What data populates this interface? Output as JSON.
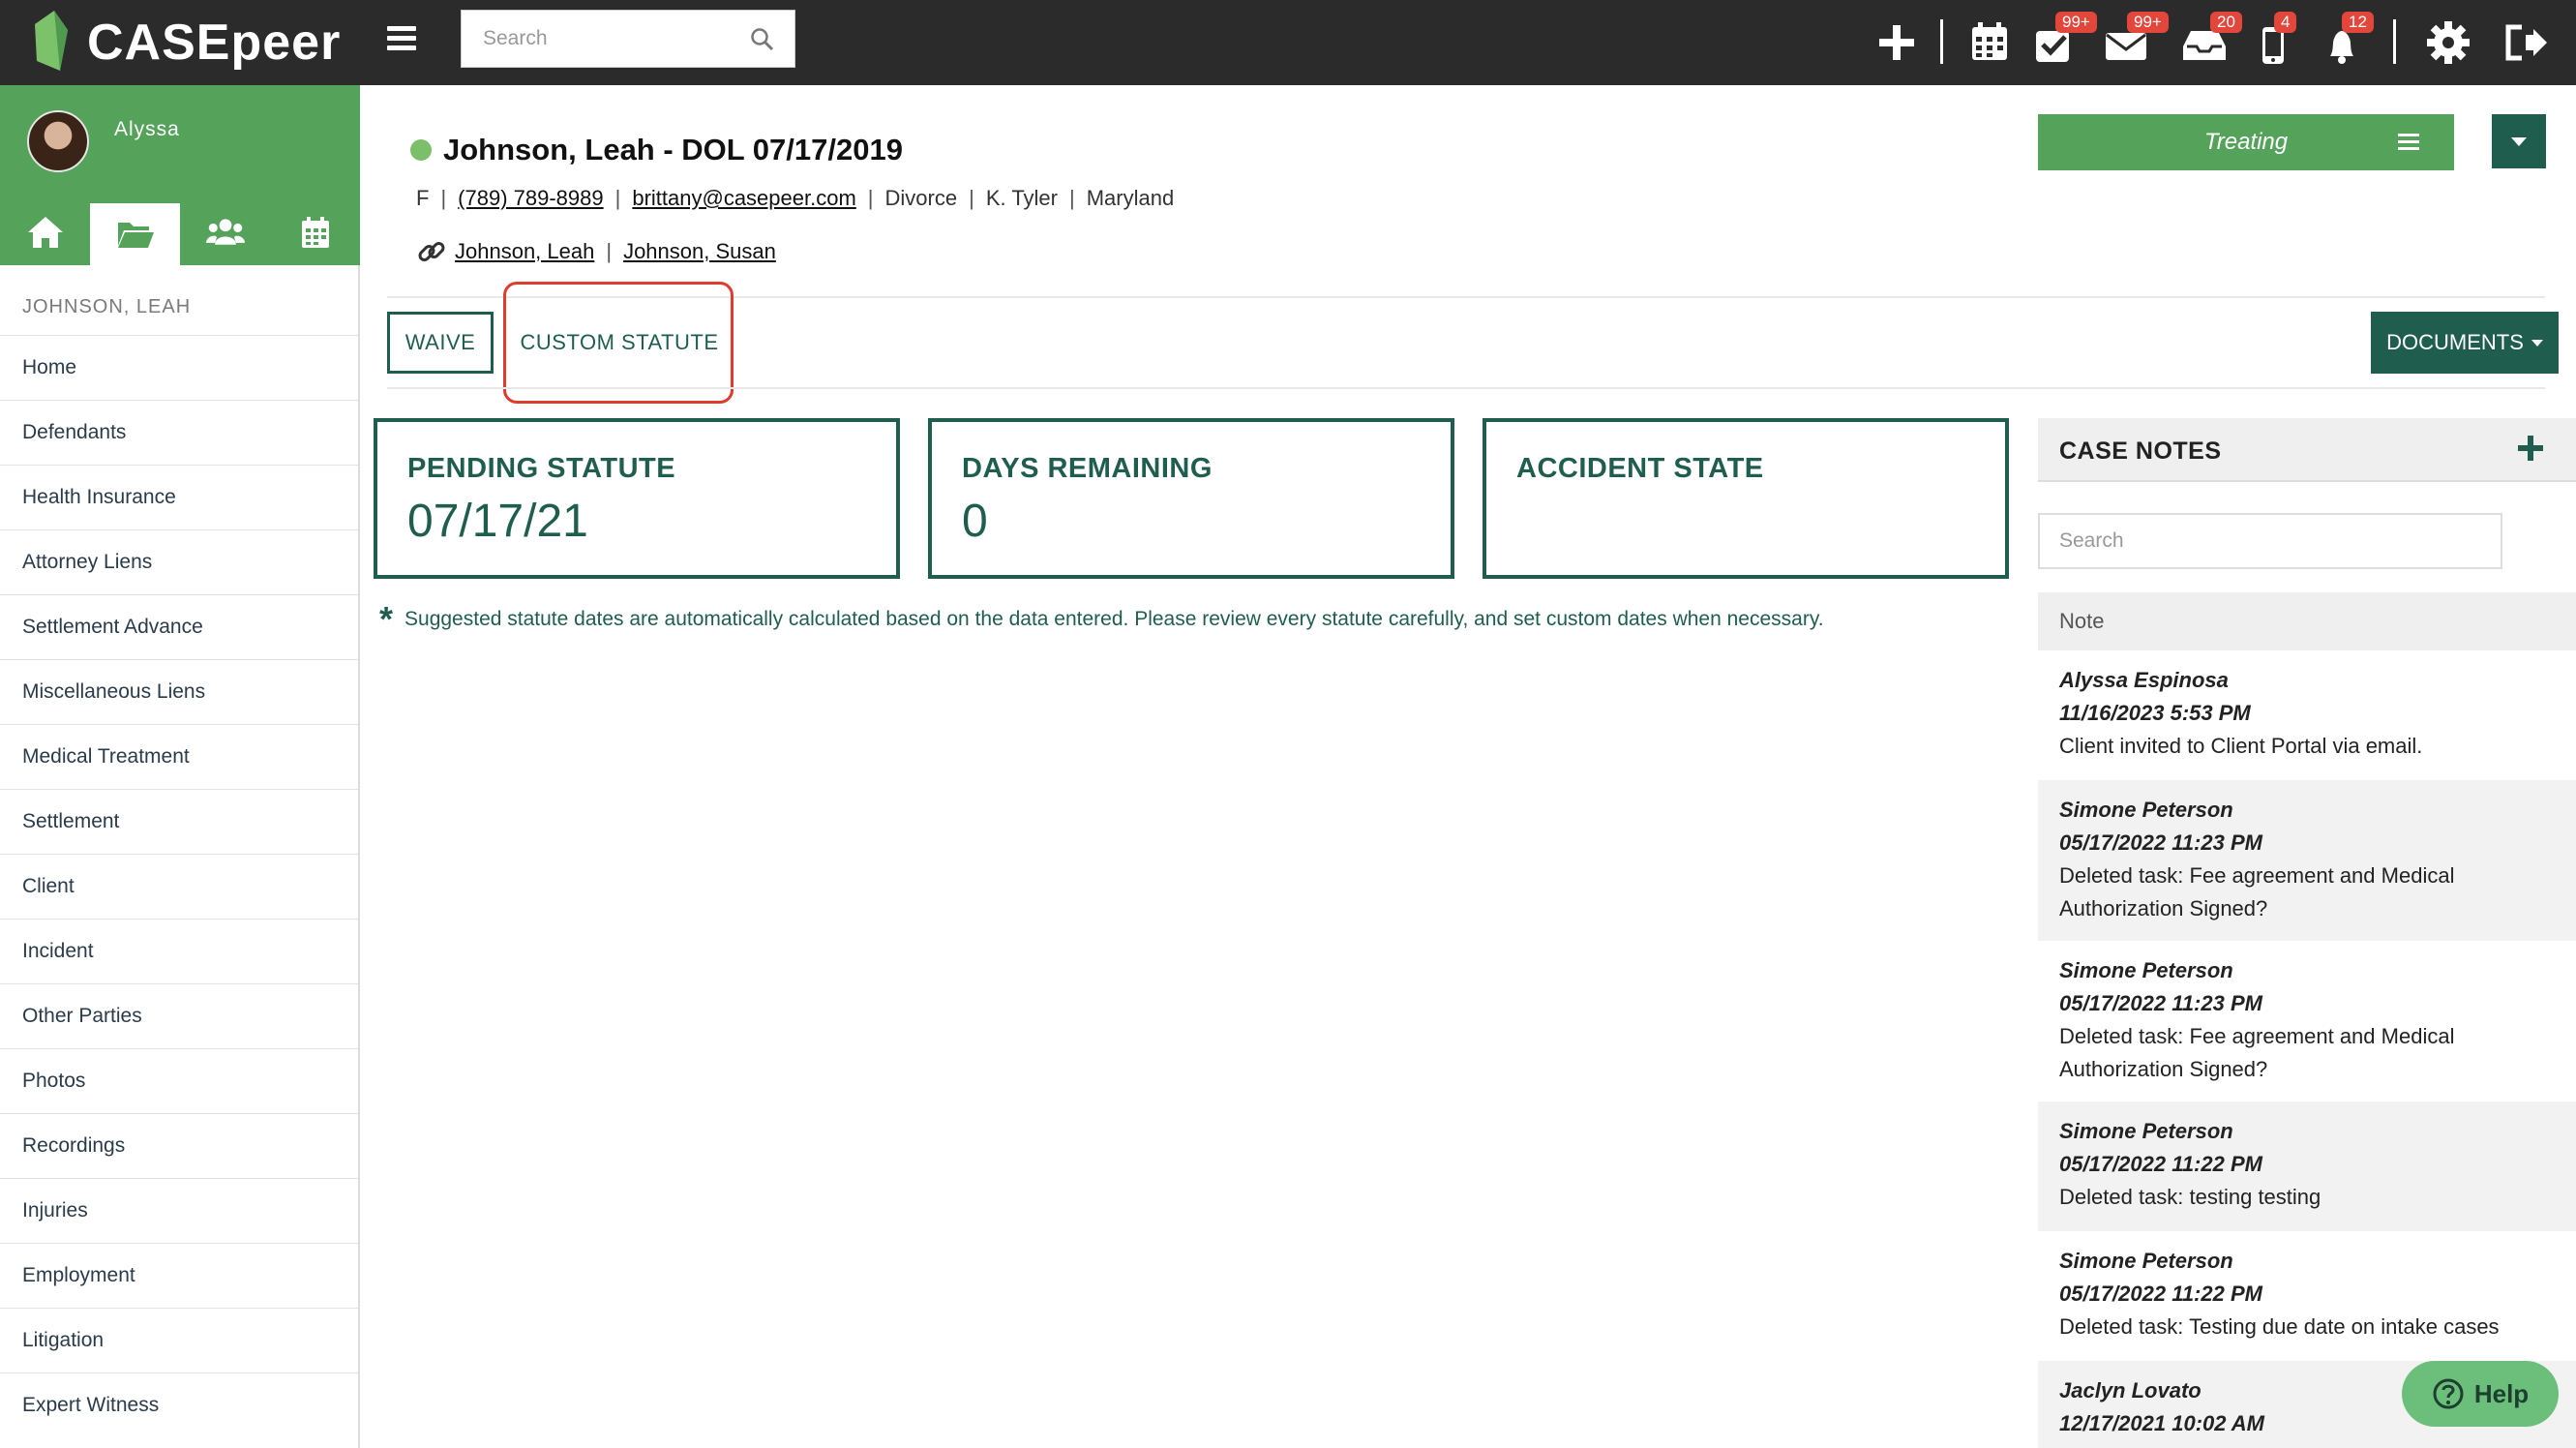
{
  "app": {
    "logo_text": "CASEpeer"
  },
  "topbar": {
    "search_placeholder": "Search",
    "badges": {
      "tasks": "99+",
      "mail": "99+",
      "inbox": "20",
      "phone": "4",
      "notifications": "12"
    }
  },
  "sidebar": {
    "user_name": "Alyssa",
    "case_label": "JOHNSON, LEAH",
    "items": [
      "Home",
      "Defendants",
      "Health Insurance",
      "Attorney Liens",
      "Settlement Advance",
      "Miscellaneous Liens",
      "Medical Treatment",
      "Settlement",
      "Client",
      "Incident",
      "Other Parties",
      "Photos",
      "Recordings",
      "Injuries",
      "Employment",
      "Litigation",
      "Expert Witness"
    ]
  },
  "case": {
    "title": "Johnson, Leah - DOL 07/17/2019",
    "gender": "F",
    "phone": "(789) 789-8989",
    "email": "brittany@casepeer.com",
    "case_type": "Divorce",
    "attorney": "K. Tyler",
    "state": "Maryland",
    "link_1": "Johnson, Leah",
    "link_2": "Johnson, Susan",
    "status": "Treating"
  },
  "actions": {
    "waive": "WAIVE",
    "custom_statute": "CUSTOM STATUTE",
    "documents": "DOCUMENTS"
  },
  "stats": {
    "pending_label": "PENDING STATUTE",
    "pending_value": "07/17/21",
    "days_label": "DAYS REMAINING",
    "days_value": "0",
    "accident_label": "ACCIDENT STATE",
    "accident_value": ""
  },
  "notice": "Suggested statute dates are automatically calculated based on the data entered. Please review every statute carefully, and set custom dates when necessary.",
  "case_notes": {
    "title": "CASE NOTES",
    "search_placeholder": "Search",
    "column": "Note",
    "notes": [
      {
        "author": "Alyssa Espinosa",
        "date": "11/16/2023 5:53 PM",
        "text1": "Client invited to Client Portal via email.",
        "text2": ""
      },
      {
        "author": "Simone Peterson",
        "date": "05/17/2022 11:23 PM",
        "text1": "Deleted task: Fee agreement and Medical",
        "text2": "Authorization Signed?"
      },
      {
        "author": "Simone Peterson",
        "date": "05/17/2022 11:23 PM",
        "text1": "Deleted task: Fee agreement and Medical",
        "text2": "Authorization Signed?"
      },
      {
        "author": "Simone Peterson",
        "date": "05/17/2022 11:22 PM",
        "text1": "Deleted task: testing testing",
        "text2": ""
      },
      {
        "author": "Simone Peterson",
        "date": "05/17/2022 11:22 PM",
        "text1": "Deleted task: Testing due date on intake cases",
        "text2": ""
      },
      {
        "author": "Jaclyn Lovato",
        "date": "12/17/2021 10:02 AM",
        "text1": "",
        "text2": ""
      }
    ]
  },
  "help": {
    "label": "Help"
  }
}
